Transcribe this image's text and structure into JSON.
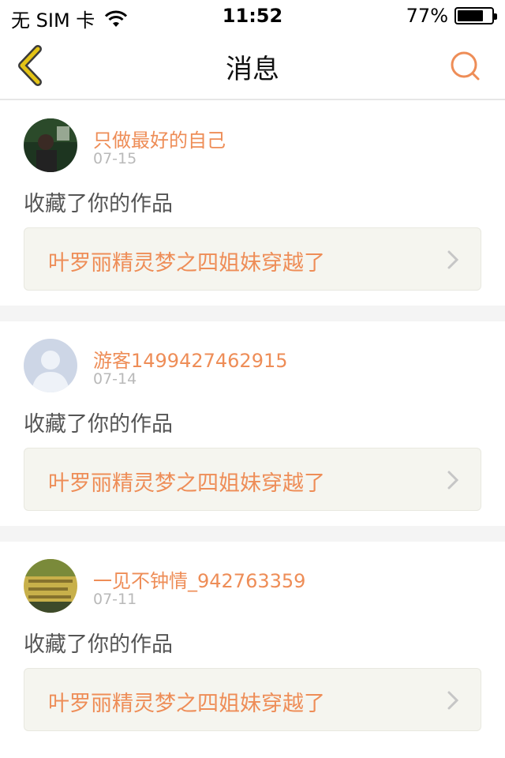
{
  "status": {
    "carrier": "无 SIM 卡",
    "time": "11:52",
    "battery": "77%",
    "battery_level": 0.77
  },
  "nav": {
    "title": "消息",
    "back_icon": "chevron-left-icon",
    "search_icon": "search-icon"
  },
  "colors": {
    "accent": "#ee8d57",
    "back_icon": "#e3c316",
    "date": "#b9b9b9"
  },
  "messages": [
    {
      "user": "只做最好的自己",
      "date": "07-15",
      "action": "收藏了你的作品",
      "work": "叶罗丽精灵梦之四姐妹穿越了"
    },
    {
      "user": "游客1499427462915",
      "date": "07-14",
      "action": "收藏了你的作品",
      "work": "叶罗丽精灵梦之四姐妹穿越了"
    },
    {
      "user": "一见不钟情_942763359",
      "date": "07-11",
      "action": "收藏了你的作品",
      "work": "叶罗丽精灵梦之四姐妹穿越了"
    }
  ]
}
